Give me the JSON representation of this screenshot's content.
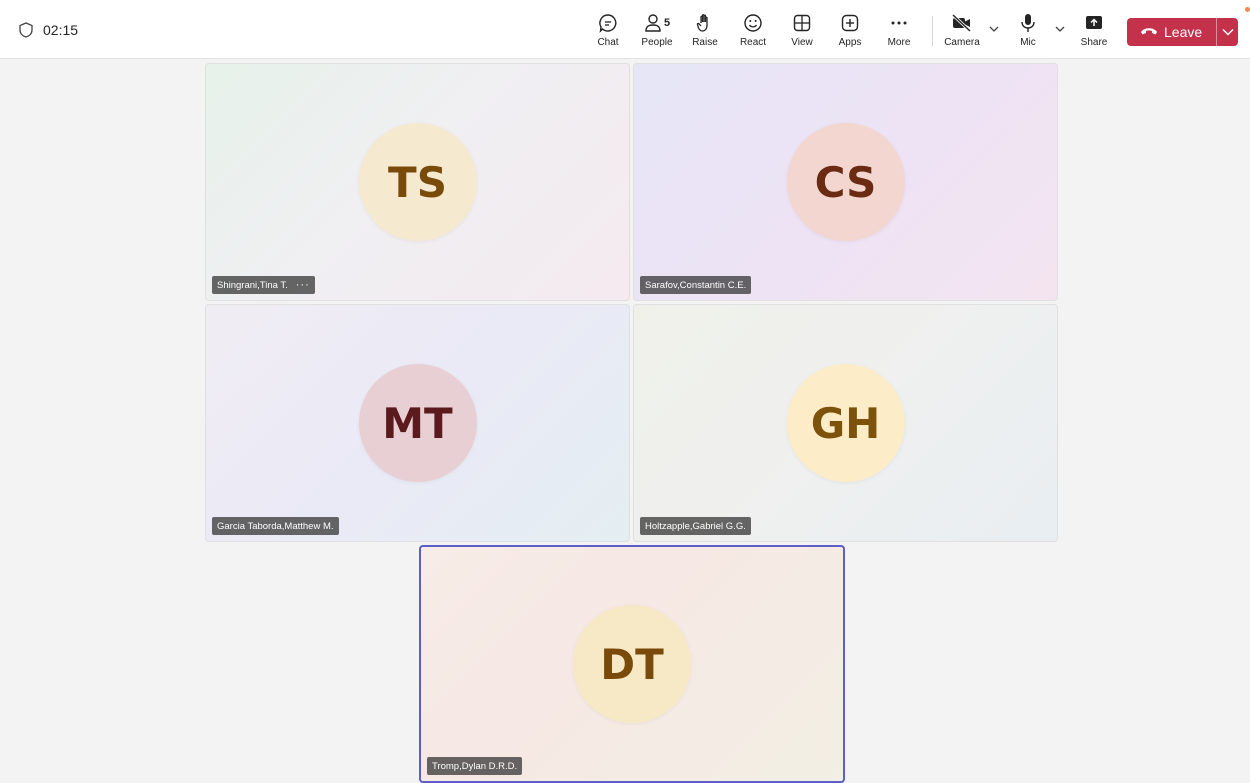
{
  "meeting": {
    "timer": "02:15"
  },
  "toolbar": {
    "chat_label": "Chat",
    "people_label": "People",
    "people_count": "5",
    "raise_label": "Raise",
    "react_label": "React",
    "view_label": "View",
    "apps_label": "Apps",
    "more_label": "More",
    "camera_label": "Camera",
    "mic_label": "Mic",
    "share_label": "Share",
    "leave_label": "Leave"
  },
  "participants": [
    {
      "initials": "TS",
      "name": "Shingrani,Tina T.",
      "avatar_bg": "#f5e9cf",
      "text_color": "#7a4a0a"
    },
    {
      "initials": "CS",
      "name": "Sarafov,Constantin C.E.",
      "avatar_bg": "#f3d6cf",
      "text_color": "#6b2a12"
    },
    {
      "initials": "MT",
      "name": "Garcia Taborda,Matthew M.",
      "avatar_bg": "#e7cfd3",
      "text_color": "#5a1a1e"
    },
    {
      "initials": "GH",
      "name": "Holtzapple,Gabriel G.G.",
      "avatar_bg": "#fcecc8",
      "text_color": "#7d520a"
    },
    {
      "initials": "DT",
      "name": "Tromp,Dylan D.R.D.",
      "avatar_bg": "#f7e9c6",
      "text_color": "#7a4a0a"
    }
  ],
  "icons": {
    "timer": "shield-icon",
    "chat": "chat-icon",
    "people": "people-icon",
    "raise": "raise-hand-icon",
    "react": "smiley-icon",
    "view": "grid-icon",
    "apps": "plus-box-icon",
    "more": "more-icon",
    "camera": "camera-off-icon",
    "mic": "mic-icon",
    "share": "share-icon",
    "leave": "phone-hangup-icon"
  },
  "colors": {
    "leave": "#c4314b",
    "active_speaker_border": "#5b5fc7",
    "notification_dot": "#f7894a"
  }
}
